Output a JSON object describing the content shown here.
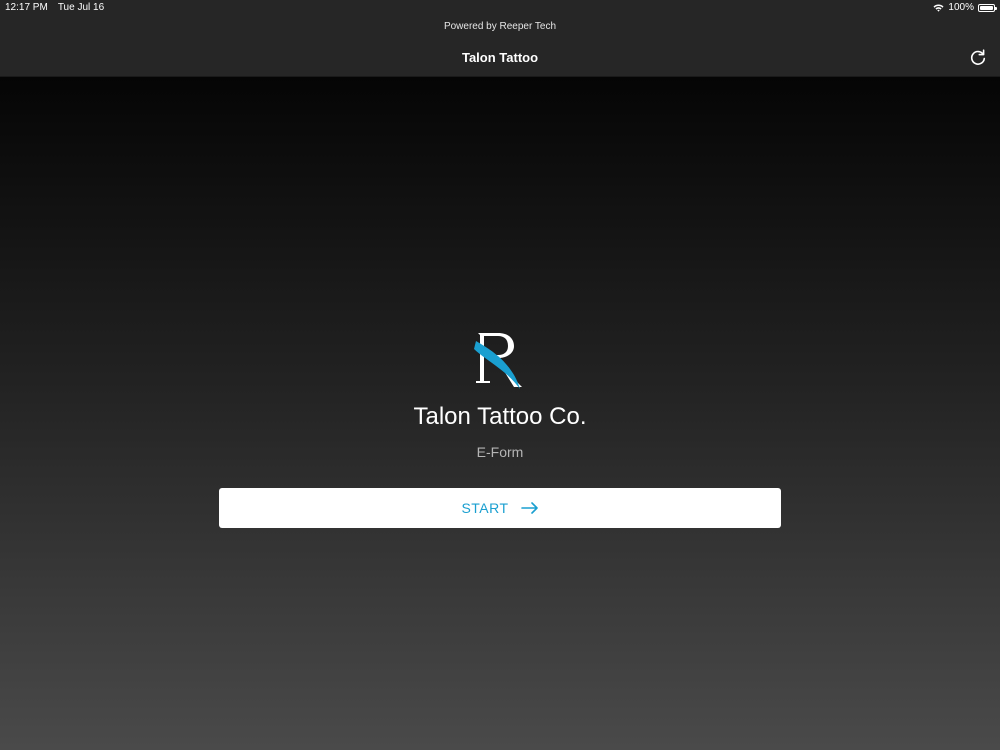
{
  "status_bar": {
    "time": "12:17 PM",
    "date": "Tue Jul 16",
    "battery_text": "100%",
    "battery_level": 1.0,
    "icons": [
      "wifi-icon",
      "battery-icon"
    ]
  },
  "nav_bar": {
    "powered_by": "Powered by Reeper Tech",
    "title": "Talon Tattoo",
    "refresh_icon": "refresh-icon"
  },
  "main": {
    "logo_icon": "talon-r-logo",
    "brand_name": "Talon Tattoo Co.",
    "form_label": "E-Form",
    "start_button": {
      "label": "START",
      "icon": "arrow-right-icon"
    }
  },
  "colors": {
    "accent": "#1a9fd0",
    "bar_background": "#262626",
    "button_background": "#ffffff",
    "logo_white": "#ffffff",
    "logo_blue": "#1a9fd0"
  }
}
